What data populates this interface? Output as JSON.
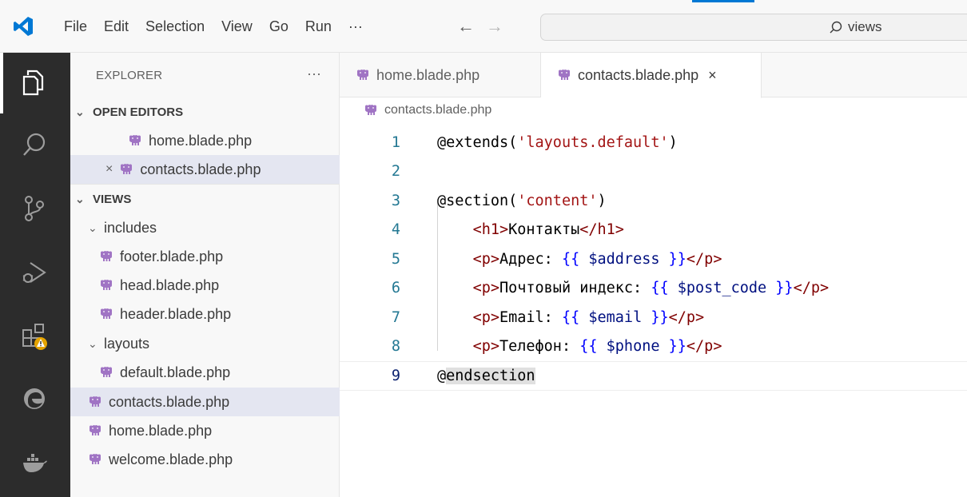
{
  "titlebar": {
    "menu": [
      "File",
      "Edit",
      "Selection",
      "View",
      "Go",
      "Run",
      "···"
    ],
    "back_arrow": "←",
    "forward_arrow": "→",
    "search_text": "views"
  },
  "activity_bar": {
    "icons": [
      "explorer-icon",
      "search-icon",
      "source-control-icon",
      "run-debug-icon",
      "extensions-icon",
      "edge-icon",
      "docker-icon"
    ]
  },
  "sidebar": {
    "title": "EXPLORER",
    "more": "···",
    "open_editors_label": "OPEN EDITORS",
    "open_editors": [
      {
        "name": "home.blade.php"
      },
      {
        "name": "contacts.blade.php"
      }
    ],
    "views_label": "VIEWS",
    "includes_label": "includes",
    "includes": [
      "footer.blade.php",
      "head.blade.php",
      "header.blade.php"
    ],
    "layouts_label": "layouts",
    "layouts": [
      "default.blade.php"
    ],
    "root_files": [
      "contacts.blade.php",
      "home.blade.php",
      "welcome.blade.php"
    ]
  },
  "editor": {
    "tabs": [
      {
        "label": "home.blade.php"
      },
      {
        "label": "contacts.blade.php"
      }
    ],
    "close_glyph": "×",
    "breadcrumb": "contacts.blade.php",
    "line_numbers": [
      "1",
      "2",
      "3",
      "4",
      "5",
      "6",
      "7",
      "8",
      "9"
    ],
    "lines": {
      "l1_kw": "@extends(",
      "l1_str": "'layouts.default'",
      "l1_end": ")",
      "l3_kw": "@section(",
      "l3_str": "'content'",
      "l3_end": ")",
      "l4_open": "<h1>",
      "l4_text": "Контакты",
      "l4_close": "</h1>",
      "l5_open": "<p>",
      "l5_text": "Адрес: ",
      "l5_var": "$address",
      "l6_open": "<p>",
      "l6_text": "Почтовый индекс: ",
      "l6_var": "$post_code",
      "l7_open": "<p>",
      "l7_text": "Email: ",
      "l7_var": "$email",
      "l8_open": "<p>",
      "l8_text": "Телефон: ",
      "l8_var": "$phone",
      "p_close": "</p>",
      "brace_open": "{{ ",
      "brace_close": " }}",
      "l9_kw": "@endsection"
    }
  },
  "colors": {
    "accent": "#0078d4",
    "activity_bar_bg": "#2c2c2c",
    "blade_icon": "#a074c4",
    "warning_badge": "#e5a400"
  }
}
